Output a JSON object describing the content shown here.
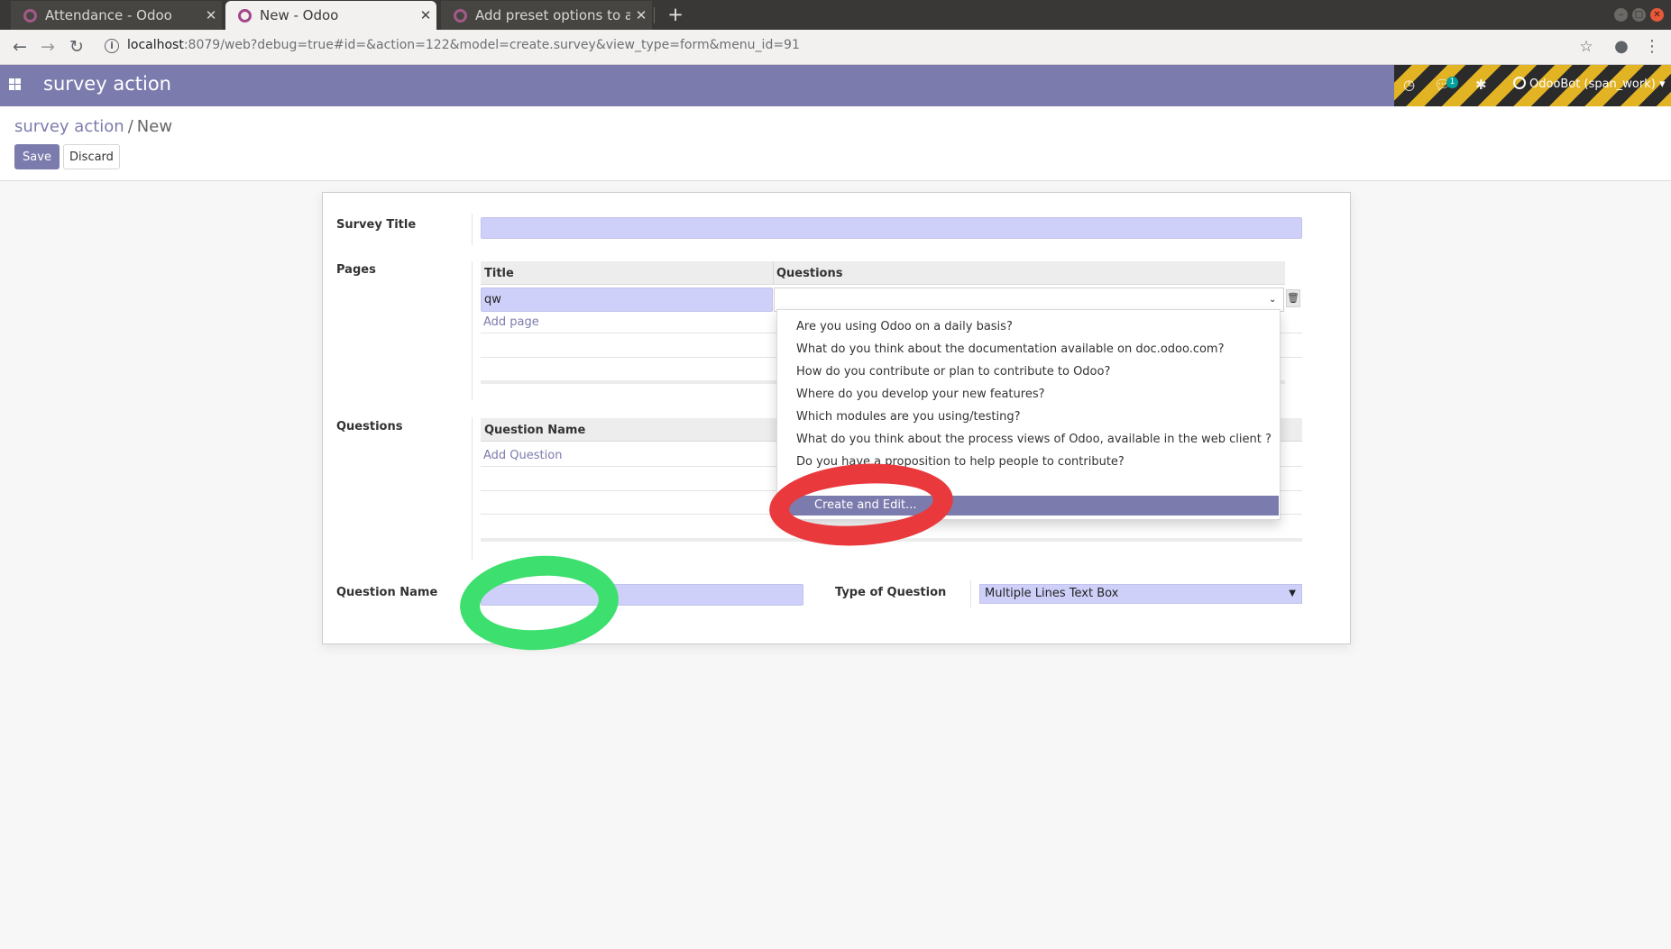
{
  "browser": {
    "tabs": [
      {
        "title": "Attendance - Odoo"
      },
      {
        "title": "New - Odoo"
      },
      {
        "title": "Add preset options to a m"
      }
    ],
    "new_tab": "+",
    "url_host": "localhost",
    "url_rest": ":8079/web?debug=true#id=&action=122&model=create.survey&view_type=form&menu_id=91"
  },
  "navbar": {
    "app_title": "survey action",
    "message_count": "1",
    "user_label": "OdooBot (span_work)"
  },
  "control_panel": {
    "breadcrumb_parent": "survey action",
    "breadcrumb_separator": "/",
    "breadcrumb_current": "New",
    "save_label": "Save",
    "discard_label": "Discard"
  },
  "form": {
    "survey_title_label": "Survey Title",
    "survey_title_value": "",
    "pages_label": "Pages",
    "pages_columns": [
      "Title",
      "Questions"
    ],
    "pages_rows": [
      {
        "title": "qw",
        "questions": ""
      }
    ],
    "add_page_label": "Add page",
    "questions_label": "Questions",
    "questions_columns": [
      "Question Name"
    ],
    "add_question_label": "Add Question",
    "question_name_label": "Question Name",
    "question_name_value": "",
    "type_of_question_label": "Type of Question",
    "type_of_question_value": "Multiple Lines Text Box"
  },
  "dropdown": {
    "items": [
      "Are you using Odoo on a daily basis?",
      "What do you think about the documentation available on doc.odoo.com?",
      "How do you contribute or plan to contribute to Odoo?",
      "Where do you develop your new features?",
      "Which modules are you using/testing?",
      "What do you think about the process views of Odoo, available in the web client ?",
      "Do you have a proposition to help people to contribute?"
    ],
    "create_edit_label": "Create and Edit..."
  },
  "colors": {
    "odoo_primary": "#7c7bad",
    "required_field": "#cfd0f9",
    "annotation_green": "#3ddf6e",
    "annotation_red": "#e9393c"
  }
}
